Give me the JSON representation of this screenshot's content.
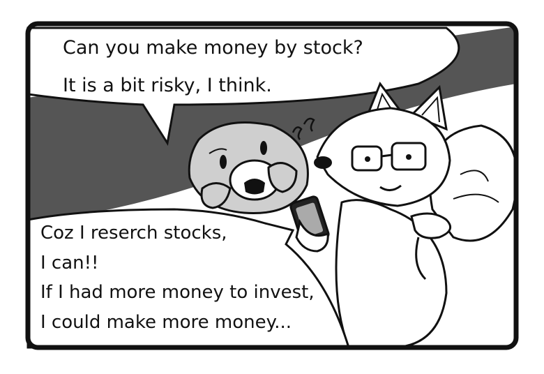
{
  "speech_top": {
    "line1": "Can you make money by stock?",
    "line2": "It is a bit risky, I think."
  },
  "speech_bottom": {
    "line1": "Coz I reserch stocks,",
    "line2": "I can!!",
    "line3": "If I had more money to invest,",
    "line4": "I could make more money..."
  },
  "colors": {
    "background_dark": "#555555",
    "background_light": "#ffffff",
    "character_gray": "#cfcfcf",
    "outline": "#111111"
  },
  "icons": [
    "smartphone-icon",
    "worry-marks-icon",
    "glasses-icon"
  ]
}
